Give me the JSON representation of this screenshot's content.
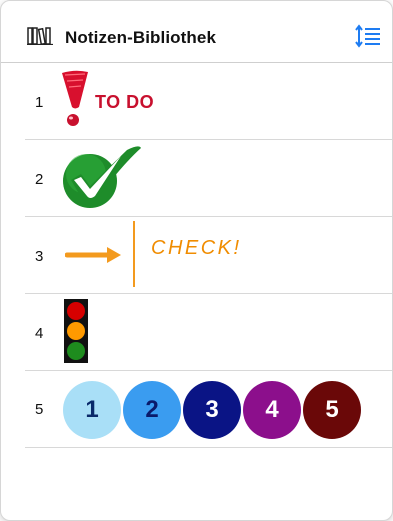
{
  "header": {
    "title": "Notizen-Bibliothek",
    "library_icon": "books-icon",
    "sort_icon": "sort-list-icon"
  },
  "rows": [
    {
      "number": "1",
      "text": "TO DO",
      "icon": "exclamation-icon"
    },
    {
      "number": "2",
      "icon": "checkmark-icon",
      "color": "#2a9a2a"
    },
    {
      "number": "3",
      "text": "CHECK!",
      "icon": "arrow-right-icon",
      "color": "#f39a1e"
    },
    {
      "number": "4",
      "icon": "traffic-light-icon"
    },
    {
      "number": "5",
      "circles": [
        {
          "label": "1",
          "bg": "#a9dff7",
          "fg": "#0a2a6a"
        },
        {
          "label": "2",
          "bg": "#3a9cf0",
          "fg": "#0a1a6a"
        },
        {
          "label": "3",
          "bg": "#0a1485",
          "fg": "#ffffff"
        },
        {
          "label": "4",
          "bg": "#8c0f8c",
          "fg": "#ffffff"
        },
        {
          "label": "5",
          "bg": "#6a0808",
          "fg": "#ffffff"
        }
      ]
    }
  ]
}
